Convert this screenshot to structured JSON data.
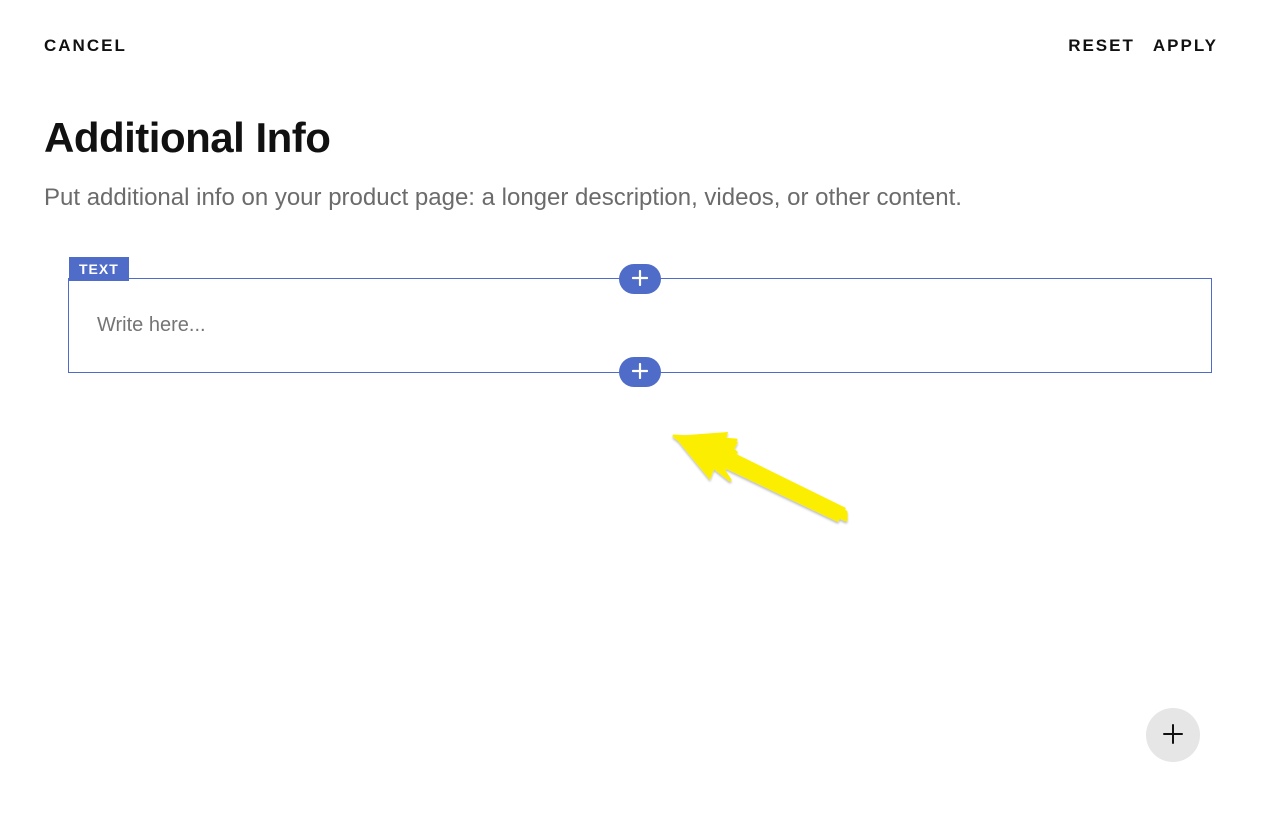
{
  "toolbar": {
    "cancel_label": "CANCEL",
    "reset_label": "RESET",
    "apply_label": "APPLY"
  },
  "page": {
    "title": "Additional Info",
    "subtitle": "Put additional info on your product page: a longer description, videos, or other content."
  },
  "block": {
    "tag_label": "TEXT",
    "placeholder": "Write here...",
    "value": ""
  },
  "colors": {
    "accent": "#4f6cc8",
    "annotation": "#fcee00"
  }
}
